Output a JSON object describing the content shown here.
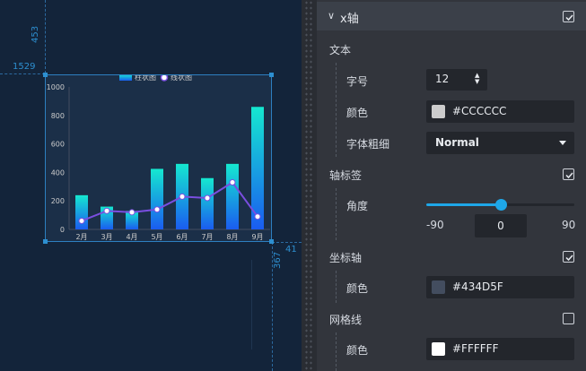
{
  "canvas": {
    "rulers": {
      "left_offset": "1529",
      "top_offset": "453",
      "right_gap": "41",
      "bottom_gap": "367"
    }
  },
  "chart_data": {
    "type": "bar",
    "categories": [
      "2月",
      "3月",
      "4月",
      "5月",
      "6月",
      "7月",
      "8月",
      "9月"
    ],
    "series": [
      {
        "name": "柱状图",
        "type": "bar",
        "values": [
          240,
          160,
          130,
          425,
          460,
          360,
          460,
          860
        ]
      },
      {
        "name": "线状图",
        "type": "line",
        "values": [
          60,
          130,
          120,
          140,
          230,
          220,
          330,
          90
        ]
      }
    ],
    "ylim": [
      0,
      1000
    ],
    "yticks": [
      "0",
      "200",
      "400",
      "600",
      "800",
      "1000"
    ],
    "legend": "top-center",
    "grid": false,
    "colors": {
      "bar_top": "#15e8d0",
      "bar_bottom": "#1a5cf0",
      "line": "#7a4ee0",
      "axis": "#434D5F",
      "text": "#CCCCCC"
    }
  },
  "panel": {
    "section_title": "x轴",
    "text_group": {
      "title": "文本",
      "font_size_label": "字号",
      "font_size_value": "12",
      "color_label": "颜色",
      "color_value": "#CCCCCC",
      "weight_label": "字体粗细",
      "weight_value": "Normal"
    },
    "axis_label": {
      "title": "轴标签",
      "checked": true,
      "angle_label": "角度",
      "angle_min": "-90",
      "angle_max": "90",
      "angle_value": "0",
      "angle_fraction": 0.5
    },
    "axis_line": {
      "title": "坐标轴",
      "checked": true,
      "color_label": "颜色",
      "color_value": "#434D5F"
    },
    "grid_line": {
      "title": "网格线",
      "checked": false,
      "color_label": "颜色",
      "color_value": "#FFFFFF"
    }
  }
}
